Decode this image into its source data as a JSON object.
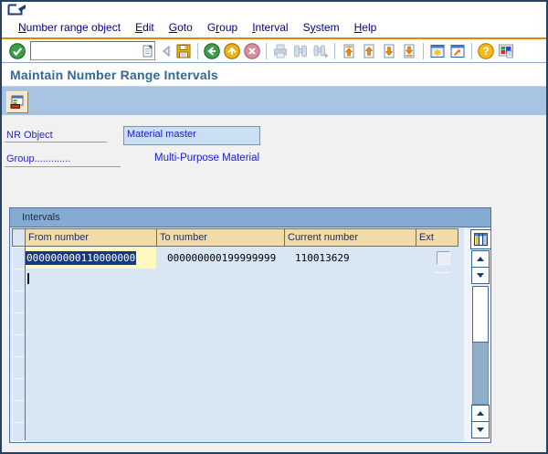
{
  "menu": {
    "items": [
      {
        "pre": "",
        "key": "N",
        "post": "umber range object"
      },
      {
        "pre": "",
        "key": "E",
        "post": "dit"
      },
      {
        "pre": "",
        "key": "G",
        "post": "oto"
      },
      {
        "pre": "G",
        "key": "r",
        "post": "oup"
      },
      {
        "pre": "",
        "key": "I",
        "post": "nterval"
      },
      {
        "pre": "S",
        "key": "y",
        "post": "stem"
      },
      {
        "pre": "",
        "key": "H",
        "post": "elp"
      }
    ]
  },
  "toolbar": {
    "command_value": ""
  },
  "title": "Maintain Number Range Intervals",
  "fields": {
    "nr_object_label": "NR Object",
    "nr_object_value": "Material master",
    "group_label": "Group.............",
    "group_value": "Multi-Purpose Material"
  },
  "intervals": {
    "caption": "Intervals",
    "columns": [
      "From number",
      "To number",
      "Current number",
      "Ext"
    ],
    "rows": [
      {
        "from": "000000000110000000",
        "to": "000000000199999999",
        "current": "110013629",
        "ext_checked": false
      }
    ]
  },
  "icons": {
    "standard_toolbar": [
      "enter-icon",
      "command-history-icon",
      "back-field-icon",
      "save-icon",
      "back-icon",
      "exit-icon",
      "cancel-icon",
      "print-icon",
      "find-icon",
      "find-next-icon",
      "first-page-icon",
      "previous-page-icon",
      "next-page-icon",
      "last-page-icon",
      "new-session-icon",
      "create-shortcut-icon",
      "help-icon",
      "customize-layout-icon"
    ],
    "application_toolbar": [
      "change-intervals-icon"
    ],
    "table": [
      "table-settings-icon",
      "scroll-up-icon",
      "scroll-down-icon"
    ]
  },
  "colors": {
    "app_toolbar_band": "#A9C3E3",
    "orange_rule": "#E08A00",
    "table_header": "#F1DCA9",
    "focused_cell": "#FFF9C0",
    "selection": "#15397E",
    "title_text": "#35688E",
    "group_caption_band": "#85ABD3"
  }
}
